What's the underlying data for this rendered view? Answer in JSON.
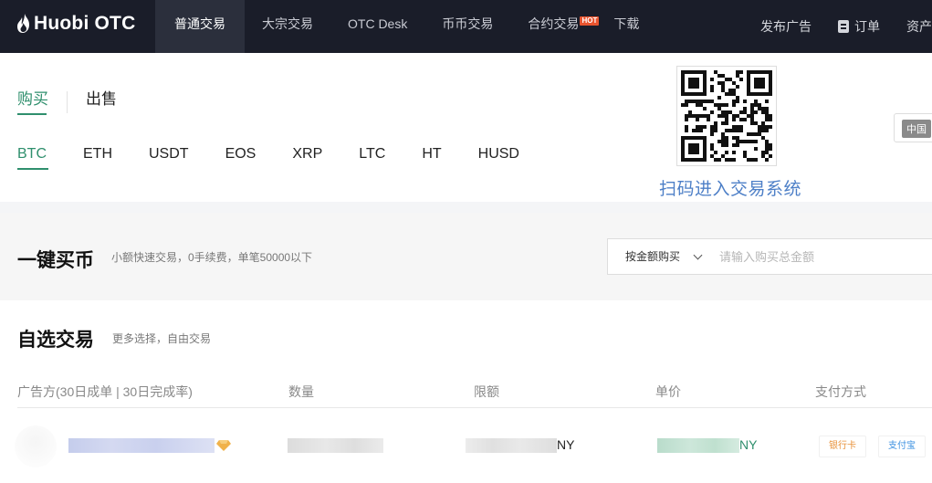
{
  "brand": {
    "logo_text": "Huobi OTC"
  },
  "nav": {
    "items": [
      {
        "label": "普通交易",
        "active": true
      },
      {
        "label": "大宗交易",
        "active": false
      },
      {
        "label": "OTC Desk",
        "active": false
      },
      {
        "label": "币币交易",
        "active": false
      },
      {
        "label": "合约交易",
        "active": false,
        "badge": "HOT"
      },
      {
        "label": "下载",
        "active": false
      }
    ],
    "right": {
      "post_ad": "发布广告",
      "orders": "订单",
      "assets": "资产"
    }
  },
  "trade_tabs": {
    "buy": "购买",
    "sell": "出售"
  },
  "coins": [
    "BTC",
    "ETH",
    "USDT",
    "EOS",
    "XRP",
    "LTC",
    "HT",
    "HUSD"
  ],
  "active_coin": "BTC",
  "qr": {
    "caption": "扫码进入交易系统"
  },
  "language": {
    "label": "中国"
  },
  "quick_buy": {
    "title": "一键买币",
    "desc": "小额快速交易，0手续费，单笔50000以下",
    "select_value": "按金额购买",
    "input_placeholder": "请输入购买总金额"
  },
  "self_select": {
    "title": "自选交易",
    "desc": "更多选择，自由交易",
    "columns": [
      "广告方(30日成单 | 30日完成率)",
      "数量",
      "限额",
      "单价",
      "支付方式"
    ],
    "rows": [
      {
        "limit_suffix": "NY",
        "price_suffix": "NY",
        "payments": [
          "银行卡",
          "支付宝"
        ]
      }
    ]
  },
  "colors": {
    "nav_bg": "#1a1d29",
    "accent_green": "#2f8f6d",
    "hot": "#e8542f",
    "qr_text": "#4d7fc7"
  }
}
